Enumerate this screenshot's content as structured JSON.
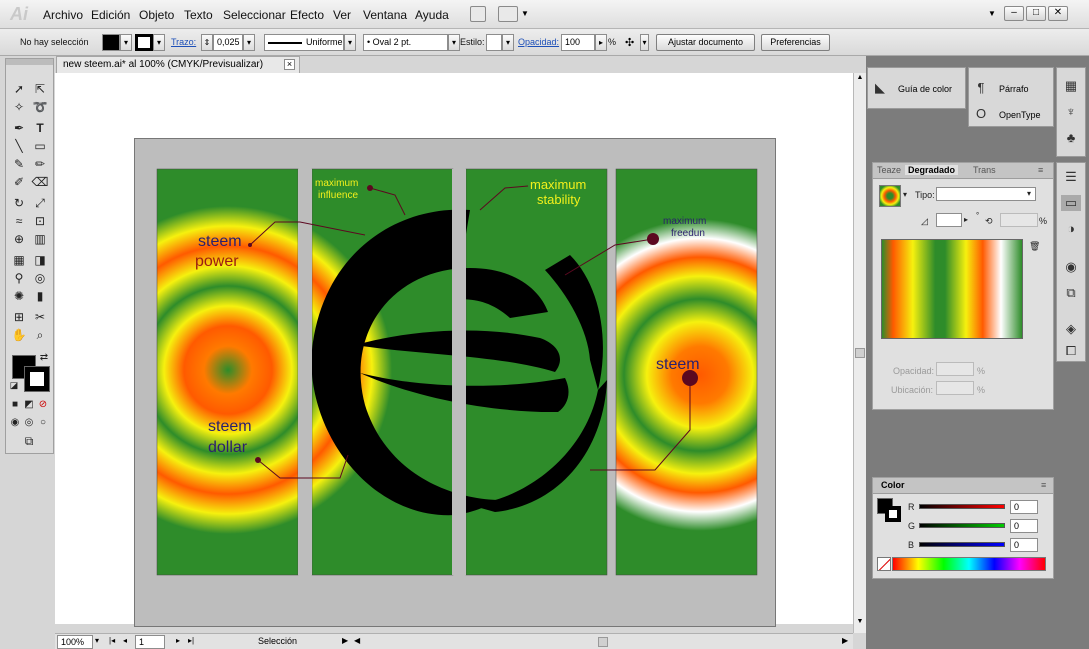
{
  "app": {
    "logo": "Ai"
  },
  "menu": [
    "Archivo",
    "Edición",
    "Objeto",
    "Texto",
    "Seleccionar",
    "Efecto",
    "Ver",
    "Ventana",
    "Ayuda"
  ],
  "control": {
    "selection_status": "No hay selección",
    "stroke_label": "Trazo:",
    "stroke_weight": "0,025",
    "stroke_style": "Uniforme",
    "brush": "Oval 2 pt.",
    "style_label": "Estilo:",
    "opacity_label": "Opacidad:",
    "opacity_value": "100",
    "percent": "%",
    "fit_button": "Ajustar documento",
    "prefs_button": "Preferencias"
  },
  "document": {
    "tab_title": "new steem.ai* al 100% (CMYK/Previsualizar)",
    "close_glyph": "×",
    "zoom": "100%",
    "page": "1",
    "status_tool": "Selección"
  },
  "artwork": {
    "labels": [
      "steem",
      "power",
      "steem",
      "dollar",
      "maximum",
      "influence",
      "maximum",
      "stability",
      "maximum",
      "freedun",
      "steem"
    ],
    "colors": {
      "green": "#2e8c2a",
      "orange": "#ff5a00",
      "yellow": "#f6f10e",
      "label_dark": "#2b1f6e",
      "label_red": "#9b1b12",
      "label_yellow": "#f2f01c",
      "dot": "#5c0820",
      "black": "#000000"
    }
  },
  "dock": {
    "color_guide": "Guía de color",
    "paragraph": "Párrafo",
    "opentype": "OpenType"
  },
  "gradient_panel": {
    "tabs": [
      "Teaze",
      "Degradado",
      "Trans"
    ],
    "type_label": "Tipo:",
    "type_value": "",
    "percent": "%",
    "opacity_label": "Opacidad:",
    "location_label": "Ubicación:"
  },
  "color_panel": {
    "title": "Color",
    "channels": [
      {
        "name": "R",
        "value": "0"
      },
      {
        "name": "G",
        "value": "0"
      },
      {
        "name": "B",
        "value": "0"
      }
    ]
  }
}
